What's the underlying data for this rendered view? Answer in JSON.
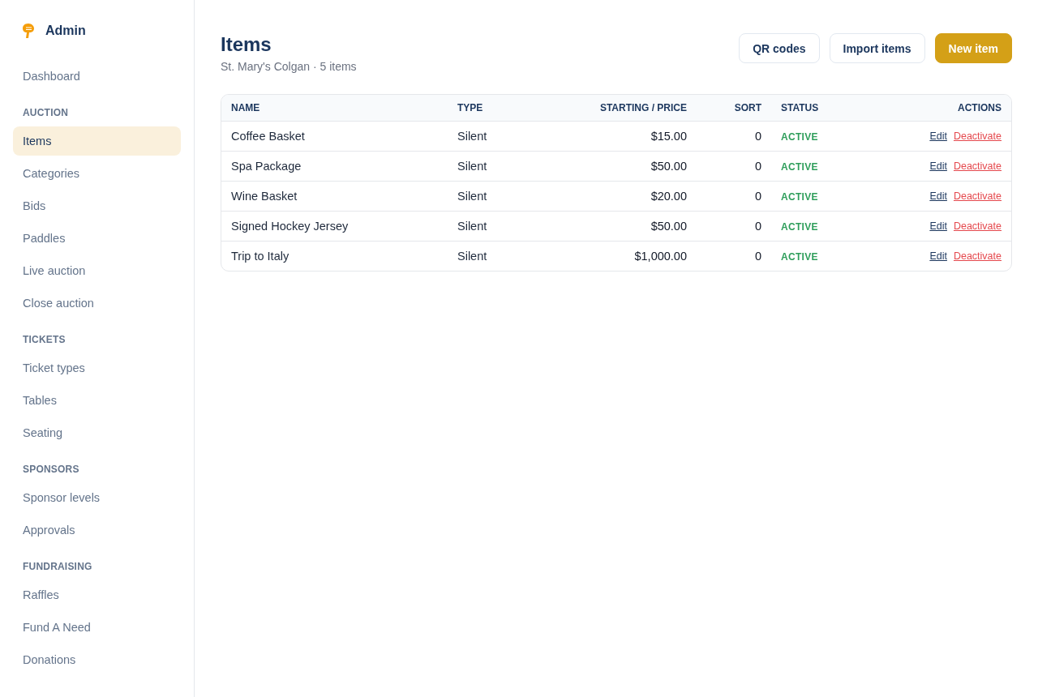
{
  "sidebar": {
    "brand": "Admin",
    "sections": [
      {
        "items": [
          {
            "label": "Dashboard",
            "selected": false
          }
        ]
      },
      {
        "heading": "AUCTION",
        "items": [
          {
            "label": "Items",
            "selected": true
          },
          {
            "label": "Categories",
            "selected": false
          },
          {
            "label": "Bids",
            "selected": false
          },
          {
            "label": "Paddles",
            "selected": false
          },
          {
            "label": "Live auction",
            "selected": false
          },
          {
            "label": "Close auction",
            "selected": false
          }
        ]
      },
      {
        "heading": "TICKETS",
        "items": [
          {
            "label": "Ticket types",
            "selected": false
          },
          {
            "label": "Tables",
            "selected": false
          },
          {
            "label": "Seating",
            "selected": false
          }
        ]
      },
      {
        "heading": "SPONSORS",
        "items": [
          {
            "label": "Sponsor levels",
            "selected": false
          },
          {
            "label": "Approvals",
            "selected": false
          }
        ]
      },
      {
        "heading": "FUNDRAISING",
        "items": [
          {
            "label": "Raffles",
            "selected": false
          },
          {
            "label": "Fund A Need",
            "selected": false
          },
          {
            "label": "Donations",
            "selected": false
          }
        ]
      }
    ]
  },
  "page": {
    "title": "Items",
    "subtitle": "St. Mary's Colgan · 5 items",
    "buttons": [
      {
        "label": "QR codes",
        "kind": "secondary"
      },
      {
        "label": "Import items",
        "kind": "secondary"
      },
      {
        "label": "New item",
        "kind": "primary"
      }
    ]
  },
  "table": {
    "columns": [
      "NAME",
      "TYPE",
      "STARTING / PRICE",
      "SORT",
      "STATUS",
      "ACTIONS"
    ],
    "rows": [
      {
        "name": "Coffee Basket",
        "type": "Silent",
        "price": "$15.00",
        "sort": "0",
        "status": {
          "label": "ACTIVE",
          "kind": "active"
        },
        "actions": [
          {
            "label": "Edit",
            "kind": "edit"
          },
          {
            "label": "Deactivate",
            "kind": "danger"
          }
        ]
      },
      {
        "name": "Spa Package",
        "type": "Silent",
        "price": "$50.00",
        "sort": "0",
        "status": {
          "label": "ACTIVE",
          "kind": "active"
        },
        "actions": [
          {
            "label": "Edit",
            "kind": "edit"
          },
          {
            "label": "Deactivate",
            "kind": "danger"
          }
        ]
      },
      {
        "name": "Wine Basket",
        "type": "Silent",
        "price": "$20.00",
        "sort": "0",
        "status": {
          "label": "ACTIVE",
          "kind": "active"
        },
        "actions": [
          {
            "label": "Edit",
            "kind": "edit"
          },
          {
            "label": "Deactivate",
            "kind": "danger"
          }
        ]
      },
      {
        "name": "Signed Hockey Jersey",
        "type": "Silent",
        "price": "$50.00",
        "sort": "0",
        "status": {
          "label": "ACTIVE",
          "kind": "active"
        },
        "actions": [
          {
            "label": "Edit",
            "kind": "edit"
          },
          {
            "label": "Deactivate",
            "kind": "danger"
          }
        ]
      },
      {
        "name": "Trip to Italy",
        "type": "Silent",
        "price": "$1,000.00",
        "sort": "0",
        "status": {
          "label": "ACTIVE",
          "kind": "active"
        },
        "actions": [
          {
            "label": "Edit",
            "kind": "edit"
          },
          {
            "label": "Deactivate",
            "kind": "danger"
          }
        ]
      }
    ]
  }
}
